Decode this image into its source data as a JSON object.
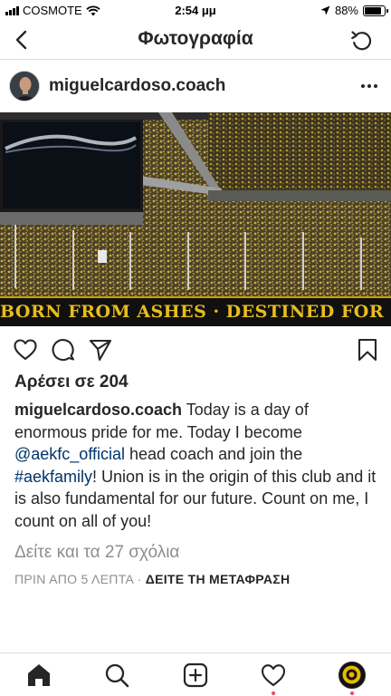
{
  "status_bar": {
    "carrier": "COSMOTE",
    "time": "2:54 μμ",
    "battery": "88%",
    "battery_level": 0.88
  },
  "nav": {
    "title": "Φωτογραφία",
    "back_icon": "chevron-left-icon",
    "refresh_icon": "refresh-icon"
  },
  "post": {
    "username": "miguelcardoso.coach",
    "more_icon": "more-icon",
    "photo_banner": "BORN FROM ASHES · DESTINED FOR GLORY",
    "likes": "Αρέσει σε 204",
    "caption": {
      "username": "miguelcardoso.coach",
      "text_1": " Today is a day of enormous pride for me. Today I become ",
      "mention": "@aekfc_official",
      "text_2": " head coach and join the ",
      "hashtag": "#aekfamily",
      "text_3": "! Union is in the origin of this club and it is also fundamental for our future. Count on me, I count on all of you!"
    },
    "comments_link": "Δείτε και τα 27 σχόλια",
    "time_ago": "ΠΡΙΝ ΑΠΟ 5 ΛΕΠΤΑ",
    "separator": " · ",
    "translate_link": "ΔΕΙΤΕ ΤΗ ΜΕΤΑΦΡΑΣΗ"
  },
  "actions": [
    "heart-icon",
    "comment-icon",
    "share-icon",
    "bookmark-icon"
  ],
  "tab_bar": [
    "home-icon",
    "search-icon",
    "add-post-icon",
    "activity-icon",
    "profile-icon"
  ],
  "colors": {
    "text": "#262626",
    "muted": "#8e8e8e",
    "link": "#003569",
    "notification": "#ed4956",
    "divider": "#dbdbdb"
  }
}
